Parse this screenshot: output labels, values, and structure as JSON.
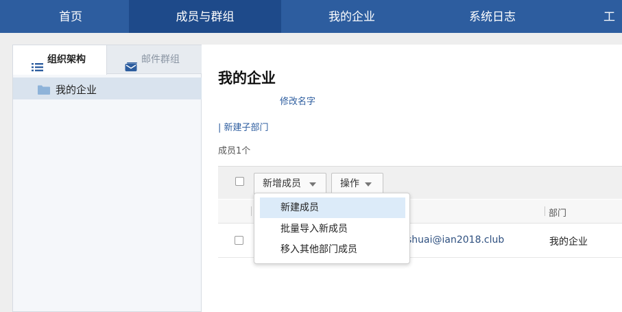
{
  "nav": {
    "items": [
      {
        "label": "首页"
      },
      {
        "label": "成员与群组"
      },
      {
        "label": "我的企业"
      },
      {
        "label": "系统日志"
      },
      {
        "label": "工"
      }
    ],
    "active_index": 1
  },
  "sidebar": {
    "tabs": [
      {
        "label": "组织架构",
        "icon": "list-icon"
      },
      {
        "label": "邮件群组",
        "icon": "mail-group-icon"
      }
    ],
    "tree": [
      {
        "label": "我的企业",
        "icon": "folder-icon"
      }
    ]
  },
  "main": {
    "title": "我的企业",
    "rename_link": "修改名字",
    "new_subdept_link": "| 新建子部门",
    "member_count": "成员1个",
    "toolbar": {
      "add_member_label": "新增成员",
      "actions_label": "操作"
    },
    "table": {
      "headers": [
        "部门"
      ],
      "rows": [
        {
          "email": "shuai@ian2018.club",
          "department": "我的企业"
        }
      ]
    },
    "dropdown": {
      "items": [
        {
          "label": "新建成员"
        },
        {
          "label": "批量导入新成员"
        },
        {
          "label": "移入其他部门成员"
        }
      ]
    }
  },
  "colors": {
    "nav_bg": "#2d5d9f",
    "nav_active": "#1e4a8a",
    "link": "#2d5d9f",
    "highlight": "#dcebf9"
  }
}
